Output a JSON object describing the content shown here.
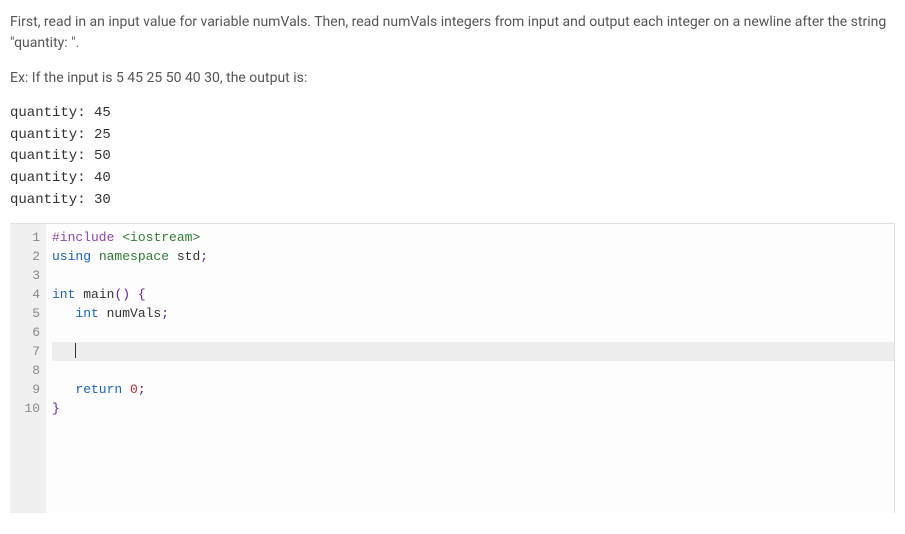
{
  "instructions": "First, read in an input value for variable numVals. Then, read numVals integers from input and output each integer on a newline after the string \"quantity: \".",
  "example_intro": "Ex: If the input is 5 45 25 50 40 30, the output is:",
  "example_output_lines": [
    "quantity: 45",
    "quantity: 25",
    "quantity: 50",
    "quantity: 40",
    "quantity: 30"
  ],
  "code": {
    "lines": [
      {
        "n": 1,
        "tokens": [
          [
            "preproc",
            "#include"
          ],
          [
            "plain",
            " "
          ],
          [
            "angle",
            "<iostream>"
          ]
        ]
      },
      {
        "n": 2,
        "tokens": [
          [
            "keyword",
            "using"
          ],
          [
            "plain",
            " "
          ],
          [
            "ns",
            "namespace"
          ],
          [
            "plain",
            " "
          ],
          [
            "ident",
            "std"
          ],
          [
            "punc",
            ";"
          ]
        ]
      },
      {
        "n": 3,
        "tokens": []
      },
      {
        "n": 4,
        "tokens": [
          [
            "type",
            "int"
          ],
          [
            "plain",
            " "
          ],
          [
            "ident",
            "main"
          ],
          [
            "punc",
            "()"
          ],
          [
            "plain",
            " "
          ],
          [
            "punc",
            "{"
          ]
        ]
      },
      {
        "n": 5,
        "tokens": [
          [
            "plain",
            "   "
          ],
          [
            "type",
            "int"
          ],
          [
            "plain",
            " "
          ],
          [
            "ident",
            "numVals"
          ],
          [
            "punc",
            ";"
          ]
        ]
      },
      {
        "n": 6,
        "tokens": []
      },
      {
        "n": 7,
        "tokens": [
          [
            "plain",
            "   "
          ]
        ],
        "active": true,
        "cursor": true
      },
      {
        "n": 8,
        "tokens": []
      },
      {
        "n": 9,
        "tokens": [
          [
            "plain",
            "   "
          ],
          [
            "keyword",
            "return"
          ],
          [
            "plain",
            " "
          ],
          [
            "num",
            "0"
          ],
          [
            "punc",
            ";"
          ]
        ]
      },
      {
        "n": 10,
        "tokens": [
          [
            "punc",
            "}"
          ]
        ]
      }
    ]
  }
}
